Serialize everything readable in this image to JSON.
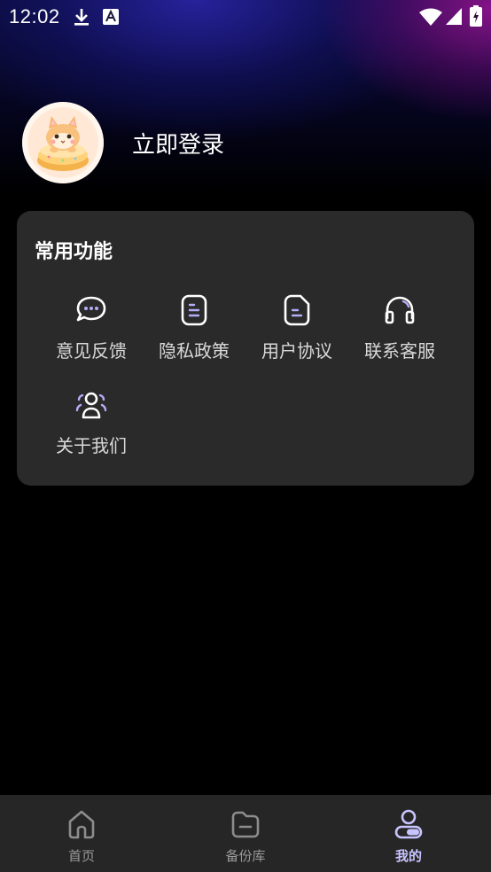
{
  "status_bar": {
    "time": "12:02",
    "icons": [
      "download-icon",
      "font-icon",
      "wifi-icon",
      "signal-icon",
      "battery-icon"
    ]
  },
  "profile": {
    "login_text": "立即登录",
    "avatar": "cat-cake-avatar"
  },
  "functions": {
    "title": "常用功能",
    "items": [
      {
        "label": "意见反馈",
        "icon": "chat-bubble-icon"
      },
      {
        "label": "隐私政策",
        "icon": "document-list-icon"
      },
      {
        "label": "用户协议",
        "icon": "file-icon"
      },
      {
        "label": "联系客服",
        "icon": "headset-icon"
      },
      {
        "label": "关于我们",
        "icon": "users-icon"
      }
    ]
  },
  "bottom_nav": {
    "items": [
      {
        "label": "首页",
        "icon": "home-icon",
        "active": false
      },
      {
        "label": "备份库",
        "icon": "folder-icon",
        "active": false
      },
      {
        "label": "我的",
        "icon": "profile-icon",
        "active": true
      }
    ]
  },
  "colors": {
    "accent": "#c8c4ff",
    "card_bg": "#2a2a2a",
    "nav_bg": "#262626"
  }
}
